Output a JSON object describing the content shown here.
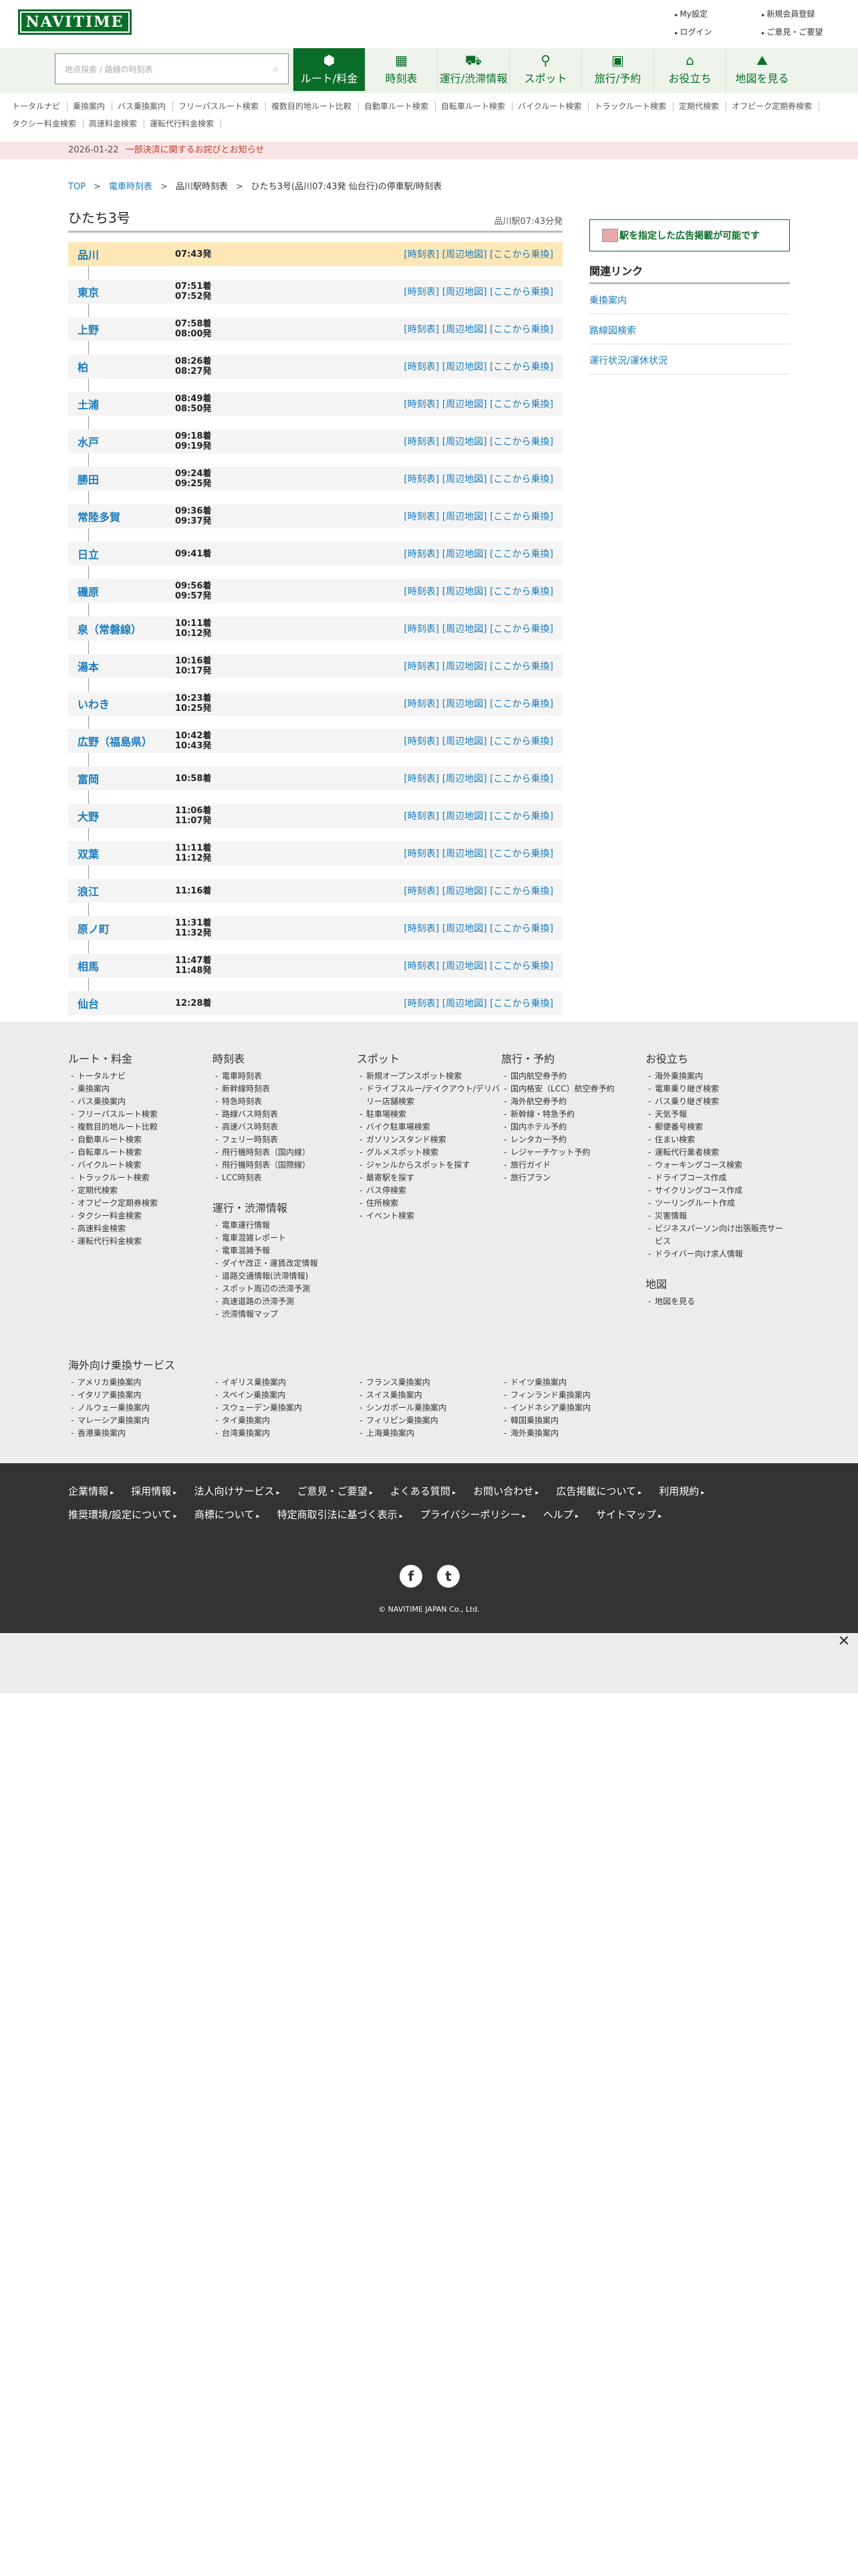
{
  "header": {
    "logo": "NAVITIME",
    "links": [
      "My設定",
      "新規会員登録",
      "ログイン",
      "ご意見・ご要望"
    ]
  },
  "search": {
    "placeholder": "地点探索 / 路線の時刻表"
  },
  "nav": {
    "tabs": [
      {
        "label": "ルート/料金",
        "icon": "route-icon"
      },
      {
        "label": "時刻表",
        "icon": "calendar-icon"
      },
      {
        "label": "運行/渋滞情報",
        "icon": "train-car-icon"
      },
      {
        "label": "スポット",
        "icon": "map-pin-icon"
      },
      {
        "label": "旅行/予約",
        "icon": "suitcase-icon"
      },
      {
        "label": "お役立ち",
        "icon": "house-icon"
      },
      {
        "label": "地図を見る",
        "icon": "map-person-icon"
      }
    ]
  },
  "subnav": [
    "トータルナビ",
    "乗換案内",
    "バス乗換案内",
    "フリーパスルート検索",
    "複数目的地ルート比較",
    "自動車ルート検索",
    "自転車ルート検索",
    "バイクルート検索",
    "トラックルート検索",
    "定期代検索",
    "オフピーク定期券検索",
    "タクシー料金検索",
    "高速料金検索",
    "運転代行料金検索"
  ],
  "notice": {
    "date": "2026-01-22",
    "text": "一部決済に関するお詫びとお知らせ"
  },
  "breadcrumb": {
    "top": "TOP",
    "timetable": "電車時刻表",
    "station": "品川駅時刻表",
    "current": "ひたち3号(品川07:43発 仙台行)の停車駅/時刻表"
  },
  "train": {
    "title": "ひたち3号",
    "departure": "品川駅07:43分発"
  },
  "links_label": "[時刻表] [周辺地図] [ここから乗換]",
  "stations": [
    {
      "name": "品川",
      "times": [
        "07:43発"
      ]
    },
    {
      "name": "東京",
      "times": [
        "07:51着",
        "07:52発"
      ]
    },
    {
      "name": "上野",
      "times": [
        "07:58着",
        "08:00発"
      ]
    },
    {
      "name": "柏",
      "times": [
        "08:26着",
        "08:27発"
      ]
    },
    {
      "name": "土浦",
      "times": [
        "08:49着",
        "08:50発"
      ]
    },
    {
      "name": "水戸",
      "times": [
        "09:18着",
        "09:19発"
      ]
    },
    {
      "name": "勝田",
      "times": [
        "09:24着",
        "09:25発"
      ]
    },
    {
      "name": "常陸多賀",
      "times": [
        "09:36着",
        "09:37発"
      ]
    },
    {
      "name": "日立",
      "times": [
        "09:41着"
      ]
    },
    {
      "name": "磯原",
      "times": [
        "09:56着",
        "09:57発"
      ]
    },
    {
      "name": "泉（常磐線）",
      "times": [
        "10:11着",
        "10:12発"
      ]
    },
    {
      "name": "湯本",
      "times": [
        "10:16着",
        "10:17発"
      ]
    },
    {
      "name": "いわき",
      "times": [
        "10:23着",
        "10:25発"
      ]
    },
    {
      "name": "広野（福島県）",
      "times": [
        "10:42着",
        "10:43発"
      ]
    },
    {
      "name": "富岡",
      "times": [
        "10:58着"
      ]
    },
    {
      "name": "大野",
      "times": [
        "11:06着",
        "11:07発"
      ]
    },
    {
      "name": "双葉",
      "times": [
        "11:11着",
        "11:12発"
      ]
    },
    {
      "name": "浪江",
      "times": [
        "11:16着"
      ]
    },
    {
      "name": "原ノ町",
      "times": [
        "11:31着",
        "11:32発"
      ]
    },
    {
      "name": "相馬",
      "times": [
        "11:47着",
        "11:48発"
      ]
    },
    {
      "name": "仙台",
      "times": [
        "12:28着"
      ]
    }
  ],
  "sidebar": {
    "ad_label": "駅を指定した広告掲載が可能です",
    "related_heading": "関連リンク",
    "related": [
      "乗換案内",
      "路線図検索",
      "運行状況/運休状況"
    ]
  },
  "footer": {
    "columns": [
      {
        "heading": "ルート・料金",
        "items": [
          "トータルナビ",
          "乗換案内",
          "バス乗換案内",
          "フリーパスルート検索",
          "複数目的地ルート比較",
          "自動車ルート検索",
          "自転車ルート検索",
          "バイクルート検索",
          "トラックルート検索",
          "定期代検索",
          "オフピーク定期券検索",
          "タクシー料金検索",
          "高速料金検索",
          "運転代行料金検索"
        ]
      },
      {
        "heading": "時刻表",
        "items": [
          "電車時刻表",
          "新幹線時刻表",
          "特急時刻表",
          "路線バス時刻表",
          "高速バス時刻表",
          "フェリー時刻表",
          "飛行機時刻表（国内線）",
          "飛行機時刻表（国際線）",
          "LCC時刻表"
        ],
        "heading2": "運行・渋滞情報",
        "items2": [
          "電車運行情報",
          "電車混雑レポート",
          "電車混雑予報",
          "ダイヤ改正・運賃改定情報",
          "道路交通情報(渋滞情報)",
          "スポット周辺の渋滞予測",
          "高速道路の渋滞予測",
          "渋滞情報マップ"
        ]
      },
      {
        "heading": "スポット",
        "items": [
          "新規オープンスポット検索",
          "ドライブスルー/テイクアウト/デリバリー店舗検索",
          "駐車場検索",
          "バイク駐車場検索",
          "ガソリンスタンド検索",
          "グルメスポット検索",
          "ジャンルからスポットを探す",
          "最寄駅を探す",
          "バス停検索",
          "住所検索",
          "イベント検索"
        ]
      },
      {
        "heading": "旅行・予約",
        "items": [
          "国内航空券予約",
          "国内格安（LCC）航空券予約",
          "海外航空券予約",
          "新幹線・特急予約",
          "国内ホテル予約",
          "レンタカー予約",
          "レジャーチケット予約",
          "旅行ガイド",
          "旅行プラン"
        ]
      },
      {
        "heading": "お役立ち",
        "items": [
          "海外乗換案内",
          "電車乗り継ぎ検索",
          "バス乗り継ぎ検索",
          "天気予報",
          "郵便番号検索",
          "住まい検索",
          "運転代行業者検索",
          "ウォーキングコース検索",
          "ドライブコース作成",
          "サイクリングコース作成",
          "ツーリングルート作成",
          "災害情報",
          "ビジネスパーソン向け出張販売サービス",
          "ドライバー向け求人情報"
        ],
        "heading2": "地図",
        "items2": [
          "地図を見る"
        ]
      }
    ],
    "overseas_heading": "海外向け乗換サービス",
    "overseas": [
      "アメリカ乗換案内",
      "イギリス乗換案内",
      "フランス乗換案内",
      "ドイツ乗換案内",
      "イタリア乗換案内",
      "スペイン乗換案内",
      "スイス乗換案内",
      "フィンランド乗換案内",
      "ノルウェー乗換案内",
      "スウェーデン乗換案内",
      "シンガポール乗換案内",
      "インドネシア乗換案内",
      "マレーシア乗換案内",
      "タイ乗換案内",
      "フィリピン乗換案内",
      "韓国乗換案内",
      "香港乗換案内",
      "台湾乗換案内",
      "上海乗換案内",
      "海外乗換案内"
    ]
  },
  "dark_links": [
    "企業情報",
    "採用情報",
    "法人向けサービス",
    "ご意見・ご要望",
    "よくある質問",
    "お問い合わせ",
    "広告掲載について",
    "利用規約",
    "推奨環境/設定について",
    "商標について",
    "特定商取引法に基づく表示",
    "プライバシーポリシー",
    "ヘルプ",
    "サイトマップ"
  ],
  "social": [
    "f",
    "t"
  ],
  "copyright": "© NAVITIME JAPAN Co., Ltd."
}
